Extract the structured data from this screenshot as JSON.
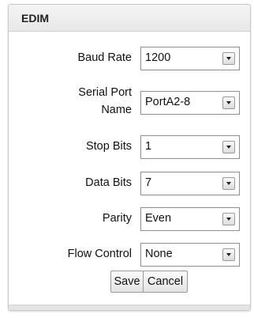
{
  "panel": {
    "title": "EDIM"
  },
  "form": {
    "fields": [
      {
        "label": "Baud Rate",
        "value": "1200"
      },
      {
        "label_line1": "Serial Port",
        "label_line2": "Name",
        "value": "PortA2-8"
      },
      {
        "label": "Stop Bits",
        "value": "1"
      },
      {
        "label": "Data Bits",
        "value": "7"
      },
      {
        "label": "Parity",
        "value": "Even"
      },
      {
        "label": "Flow Control",
        "value": "None"
      }
    ]
  },
  "buttons": {
    "save_label": "Save",
    "cancel_label": "Cancel"
  },
  "icons": {
    "dropdown": "chevron-down-icon"
  }
}
